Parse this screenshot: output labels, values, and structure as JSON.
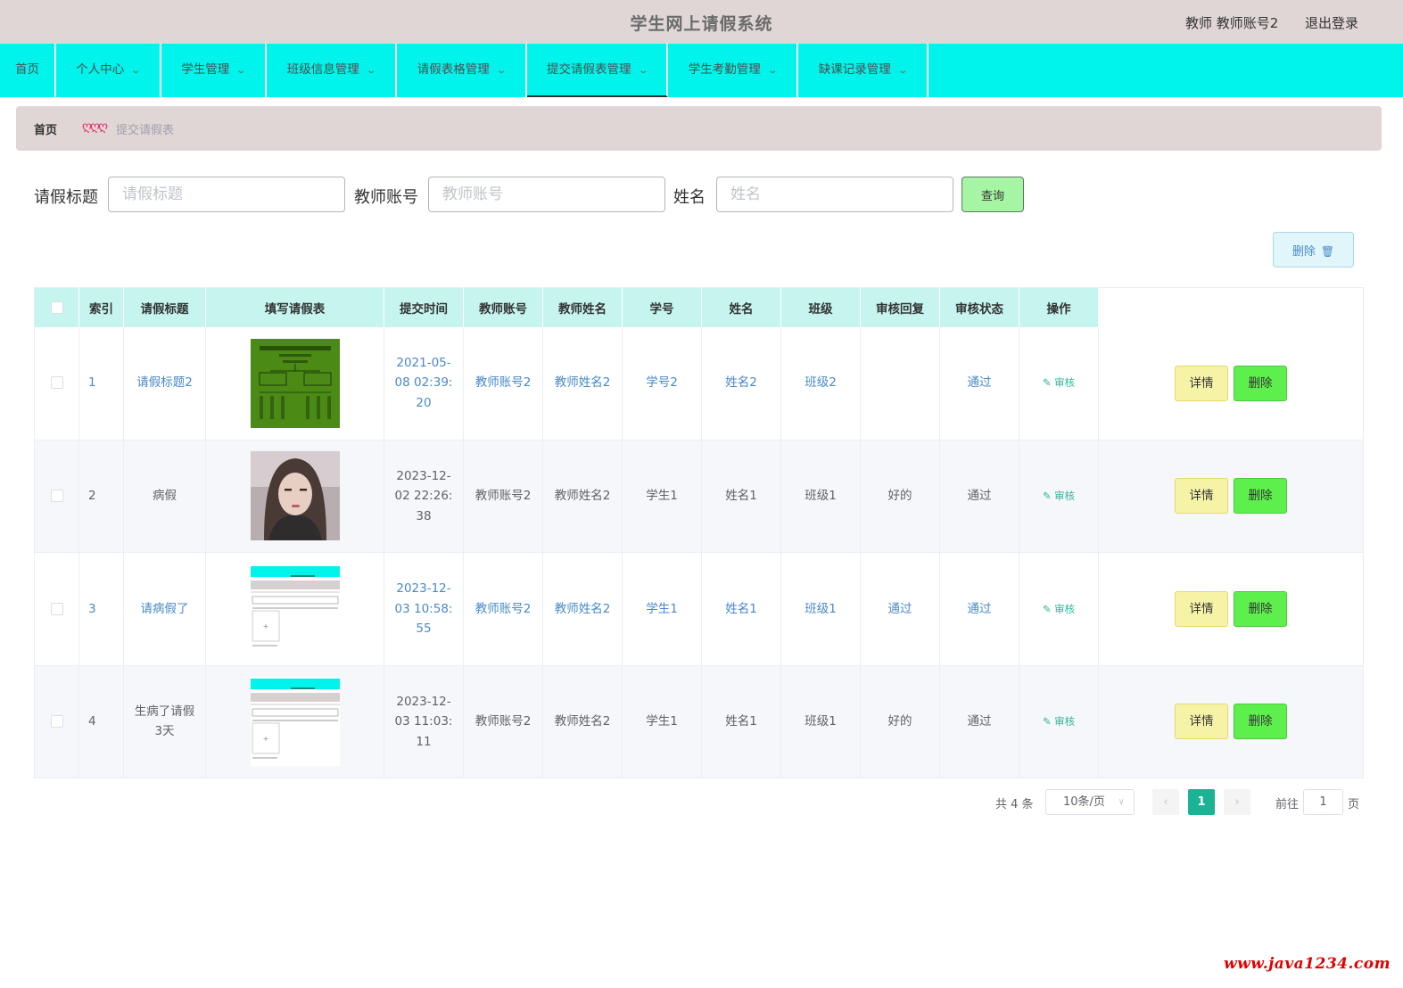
{
  "header": {
    "title": "学生网上请假系统",
    "user": "教师 教师账号2",
    "logout": "退出登录"
  },
  "nav": {
    "items": [
      {
        "label": "首页"
      },
      {
        "label": "个人中心"
      },
      {
        "label": "学生管理"
      },
      {
        "label": "班级信息管理"
      },
      {
        "label": "请假表格管理"
      },
      {
        "label": "提交请假表管理"
      },
      {
        "label": "学生考勤管理"
      },
      {
        "label": "缺课记录管理"
      }
    ],
    "active": "提交请假表管理"
  },
  "breadcrumb": {
    "home": "首页",
    "separator": "ღღღ",
    "current": "提交请假表"
  },
  "search": {
    "fields": [
      {
        "label": "请假标题",
        "placeholder": "请假标题",
        "value": ""
      },
      {
        "label": "教师账号",
        "placeholder": "教师账号",
        "value": ""
      },
      {
        "label": "姓名",
        "placeholder": "姓名",
        "value": ""
      }
    ],
    "query_button": "查询"
  },
  "toolbar": {
    "delete_label": "删除",
    "delete_icon": "trash-icon"
  },
  "table": {
    "columns": [
      "索引",
      "请假标题",
      "填写请假表",
      "提交时间",
      "教师账号",
      "教师姓名",
      "学号",
      "姓名",
      "班级",
      "审核回复",
      "审核状态",
      "审核",
      "操作"
    ],
    "review_label": "审核",
    "detail_label": "详情",
    "delete_label": "删除",
    "rows": [
      {
        "index": "1",
        "title": "请假标题2",
        "image": "green-chart-image",
        "time": "2021-05-08 02:39:20",
        "time_lines": [
          "2021-05-",
          "08 02:39:",
          "20"
        ],
        "teacher_account": "教师账号2",
        "teacher_name": "教师姓名2",
        "student_no": "学号2",
        "name": "姓名2",
        "class": "班级2",
        "reply": "",
        "status": "通过",
        "link_style": true
      },
      {
        "index": "2",
        "title": "病假",
        "image": "portrait-photo",
        "time": "2023-12-02 22:26:38",
        "time_lines": [
          "2023-12-",
          "02 22:26:",
          "38"
        ],
        "teacher_account": "教师账号2",
        "teacher_name": "教师姓名2",
        "student_no": "学生1",
        "name": "姓名1",
        "class": "班级1",
        "reply": "好的",
        "status": "通过",
        "link_style": false
      },
      {
        "index": "3",
        "title": "请病假了",
        "image": "screenshot-thumbnail",
        "time": "2023-12-03 10:58:55",
        "time_lines": [
          "2023-12-",
          "03 10:58:",
          "55"
        ],
        "teacher_account": "教师账号2",
        "teacher_name": "教师姓名2",
        "student_no": "学生1",
        "name": "姓名1",
        "class": "班级1",
        "reply": "通过",
        "status": "通过",
        "link_style": true
      },
      {
        "index": "4",
        "title_lines": [
          "生病了请假",
          "3天"
        ],
        "title": "生病了请假3天",
        "image": "screenshot-thumbnail",
        "time": "2023-12-03 11:03:11",
        "time_lines": [
          "2023-12-",
          "03 11:03:",
          "11"
        ],
        "teacher_account": "教师账号2",
        "teacher_name": "教师姓名2",
        "student_no": "学生1",
        "name": "姓名1",
        "class": "班级1",
        "reply": "好的",
        "status": "通过",
        "link_style": false
      }
    ]
  },
  "pagination": {
    "total": "共 4 条",
    "page_size": "10条/页",
    "current_page": "1",
    "goto_prefix": "前往",
    "goto_value": "1",
    "goto_suffix": "页"
  },
  "watermark": "www.java1234.com",
  "colors": {
    "header_bg": "#e0d6d6",
    "nav_bg": "#00f4ec",
    "table_header_bg": "#c5f5ee",
    "query_button": "#a6f5a4",
    "detail_button": "#f6f3a7",
    "delete_button": "#5df04c",
    "link": "#4a89c8",
    "pagination_active": "#1ab394"
  }
}
